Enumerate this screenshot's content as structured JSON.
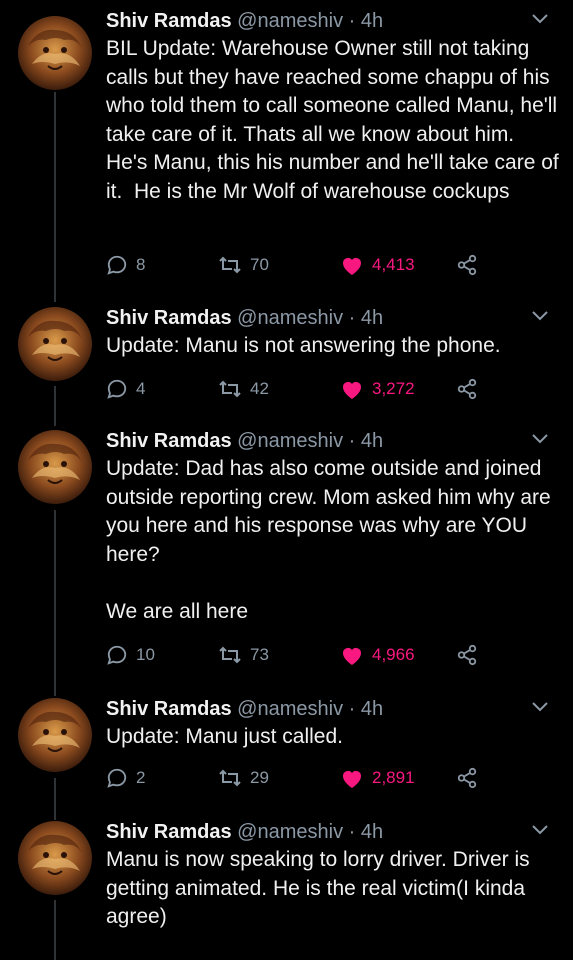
{
  "tweets": [
    {
      "name": "Shiv Ramdas",
      "handle": "@nameshiv",
      "sep": "·",
      "time": "4h",
      "text": "BIL Update: Warehouse Owner still not taking calls but they have reached some chappu of his who told them to call someone called Manu, he'll take care of it. Thats all we know about him. He's Manu, this his number and he'll take care of it.  He is the Mr Wolf of warehouse cockups",
      "replies": "8",
      "retweets": "70",
      "likes": "4,413"
    },
    {
      "name": "Shiv Ramdas",
      "handle": "@nameshiv",
      "sep": "·",
      "time": "4h",
      "text": "Update: Manu is not answering the phone.",
      "replies": "4",
      "retweets": "42",
      "likes": "3,272"
    },
    {
      "name": "Shiv Ramdas",
      "handle": "@nameshiv",
      "sep": "·",
      "time": "4h",
      "text": "Update: Dad has also come outside and joined outside reporting crew. Mom asked him why are you here and his response was why are YOU here?\n\nWe are all here",
      "replies": "10",
      "retweets": "73",
      "likes": "4,966"
    },
    {
      "name": "Shiv Ramdas",
      "handle": "@nameshiv",
      "sep": "·",
      "time": "4h",
      "text": "Update: Manu just called.",
      "replies": "2",
      "retweets": "29",
      "likes": "2,891"
    },
    {
      "name": "Shiv Ramdas",
      "handle": "@nameshiv",
      "sep": "·",
      "time": "4h",
      "text": "Manu is now speaking to lorry driver. Driver is getting animated. He is the real victim(I kinda agree)"
    }
  ],
  "icons": {
    "reply": "reply-icon",
    "retweet": "retweet-icon",
    "like": "heart-icon",
    "share": "share-icon",
    "menu": "chevron-down-icon"
  },
  "colors": {
    "background": "#000000",
    "like": "#f91880",
    "muted": "#8b98a5"
  }
}
